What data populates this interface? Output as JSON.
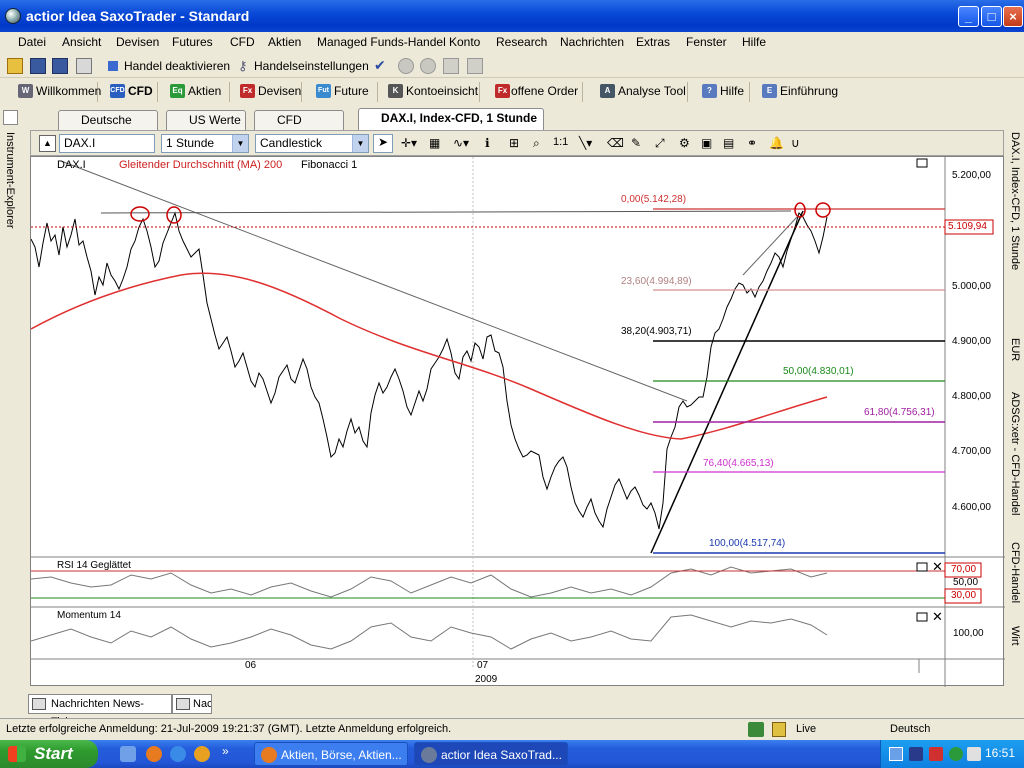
{
  "window": {
    "title": "actior Idea SaxoTrader - Standard"
  },
  "menu": [
    "Datei",
    "Ansicht",
    "Devisen",
    "Futures",
    "CFD",
    "Aktien",
    "Managed Funds-Handel",
    "Konto",
    "Research",
    "Nachrichten",
    "Extras",
    "Fenster",
    "Hilfe"
  ],
  "toolbar1": {
    "trade_off": "Handel deaktivieren",
    "trade_settings": "Handelseinstellungen"
  },
  "toolbar2": [
    {
      "label": "Willkommen",
      "icon": "W",
      "color": "#666"
    },
    {
      "label": "CFD",
      "icon": "CFD",
      "color": "#2a5fc0"
    },
    {
      "label": "Aktien",
      "icon": "Eq",
      "color": "#2a9a3a"
    },
    {
      "label": "Devisen",
      "icon": "Fx",
      "color": "#c02a2a"
    },
    {
      "label": "Future",
      "icon": "Fut",
      "color": "#3a8ad0"
    },
    {
      "label": "Kontoeinsicht",
      "icon": "K",
      "color": "#555"
    },
    {
      "label": "offene Order",
      "icon": "Fx",
      "color": "#c02a2a"
    },
    {
      "label": "Analyse Tool",
      "icon": "A",
      "color": "#456"
    },
    {
      "label": "Hilfe",
      "icon": "?",
      "color": "#5a7ac0"
    },
    {
      "label": "Einführung",
      "icon": "E",
      "color": "#5a7ac0"
    }
  ],
  "left_panel": "Instrument-Explorer",
  "right_panel": [
    "DAX.I, Index-CFD, 1 Stunde",
    "EUR",
    "ADSG:xetr - CFD-Handel",
    "CFD-Handel",
    "Wirt"
  ],
  "tabs": [
    "Deutsche Werte",
    "US Werte",
    "CFD Indizes",
    "DAX.I, Index-CFD, 1 Stunde"
  ],
  "chart_toolbar": {
    "instrument": "DAX.I",
    "period": "1 Stunde",
    "style": "Candlestick"
  },
  "indicator_labels": {
    "instrument": "DAX.I",
    "ma": "Gleitender Durchschnitt (MA) 200",
    "fib": "Fibonacci 1"
  },
  "colors": {
    "ma": "#e03030",
    "fib0": "#d03030",
    "fib236": "#d09090",
    "fib382": "#000000",
    "fib50": "#1a8a1a",
    "fib618": "#a020a0",
    "fib764": "#d030d0",
    "fib100": "#1a3ab0",
    "price": "#cc0000"
  },
  "fib_levels": [
    {
      "label": "0,00(5.142,28)",
      "price": 5142.28
    },
    {
      "label": "23,60(4.994,89)",
      "price": 4994.89
    },
    {
      "label": "38,20(4.903,71)",
      "price": 4903.71
    },
    {
      "label": "50,00(4.830,01)",
      "price": 4830.01
    },
    {
      "label": "61,80(4.756,31)",
      "price": 4756.31
    },
    {
      "label": "76,40(4.665,13)",
      "price": 4665.13
    },
    {
      "label": "100,00(4.517,74)",
      "price": 4517.74
    }
  ],
  "price_axis": [
    "5.200,00",
    "5.100,00",
    "5.000,00",
    "4.900,00",
    "4.800,00",
    "4.700,00",
    "4.600,00"
  ],
  "current_price": "5.109,94",
  "rsi": {
    "label": "RSI 14 Geglättet",
    "upper": "70,00",
    "mid": "50,00",
    "lower": "30,00"
  },
  "momentum": {
    "label": "Momentum 14",
    "mid": "100,00"
  },
  "time_axis": {
    "t1": "06",
    "t2": "07",
    "year": "2009"
  },
  "bottom_tabs": [
    "Nachrichten News-Ticker",
    "Nac"
  ],
  "status": {
    "message": "Letzte erfolgreiche Anmeldung: 21-Jul-2009 19:21:37 (GMT). Letzte Anmeldung erfolgreich.",
    "mode": "Live",
    "language": "Deutsch"
  },
  "taskbar": {
    "start": "Start",
    "tasks": [
      "Aktien, Börse, Aktien...",
      "actior Idea SaxoTrad..."
    ],
    "clock": "16:51"
  }
}
